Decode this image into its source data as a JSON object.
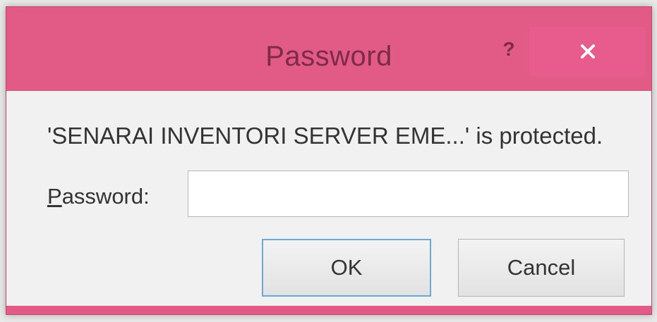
{
  "dialog": {
    "title": "Password",
    "help_icon": "help-icon",
    "close_icon": "close-icon",
    "message": "'SENARAI INVENTORI SERVER EME...' is protected.",
    "password_label_accesskey": "P",
    "password_label_rest": "assword:",
    "password_value": "",
    "ok_label": "OK",
    "cancel_label": "Cancel"
  },
  "colors": {
    "frame": "#e25a86",
    "close_button": "#e75c8d",
    "title_text": "#7d2b48",
    "client_bg": "#f1f1f1",
    "default_button_border": "#6aa9d8"
  }
}
